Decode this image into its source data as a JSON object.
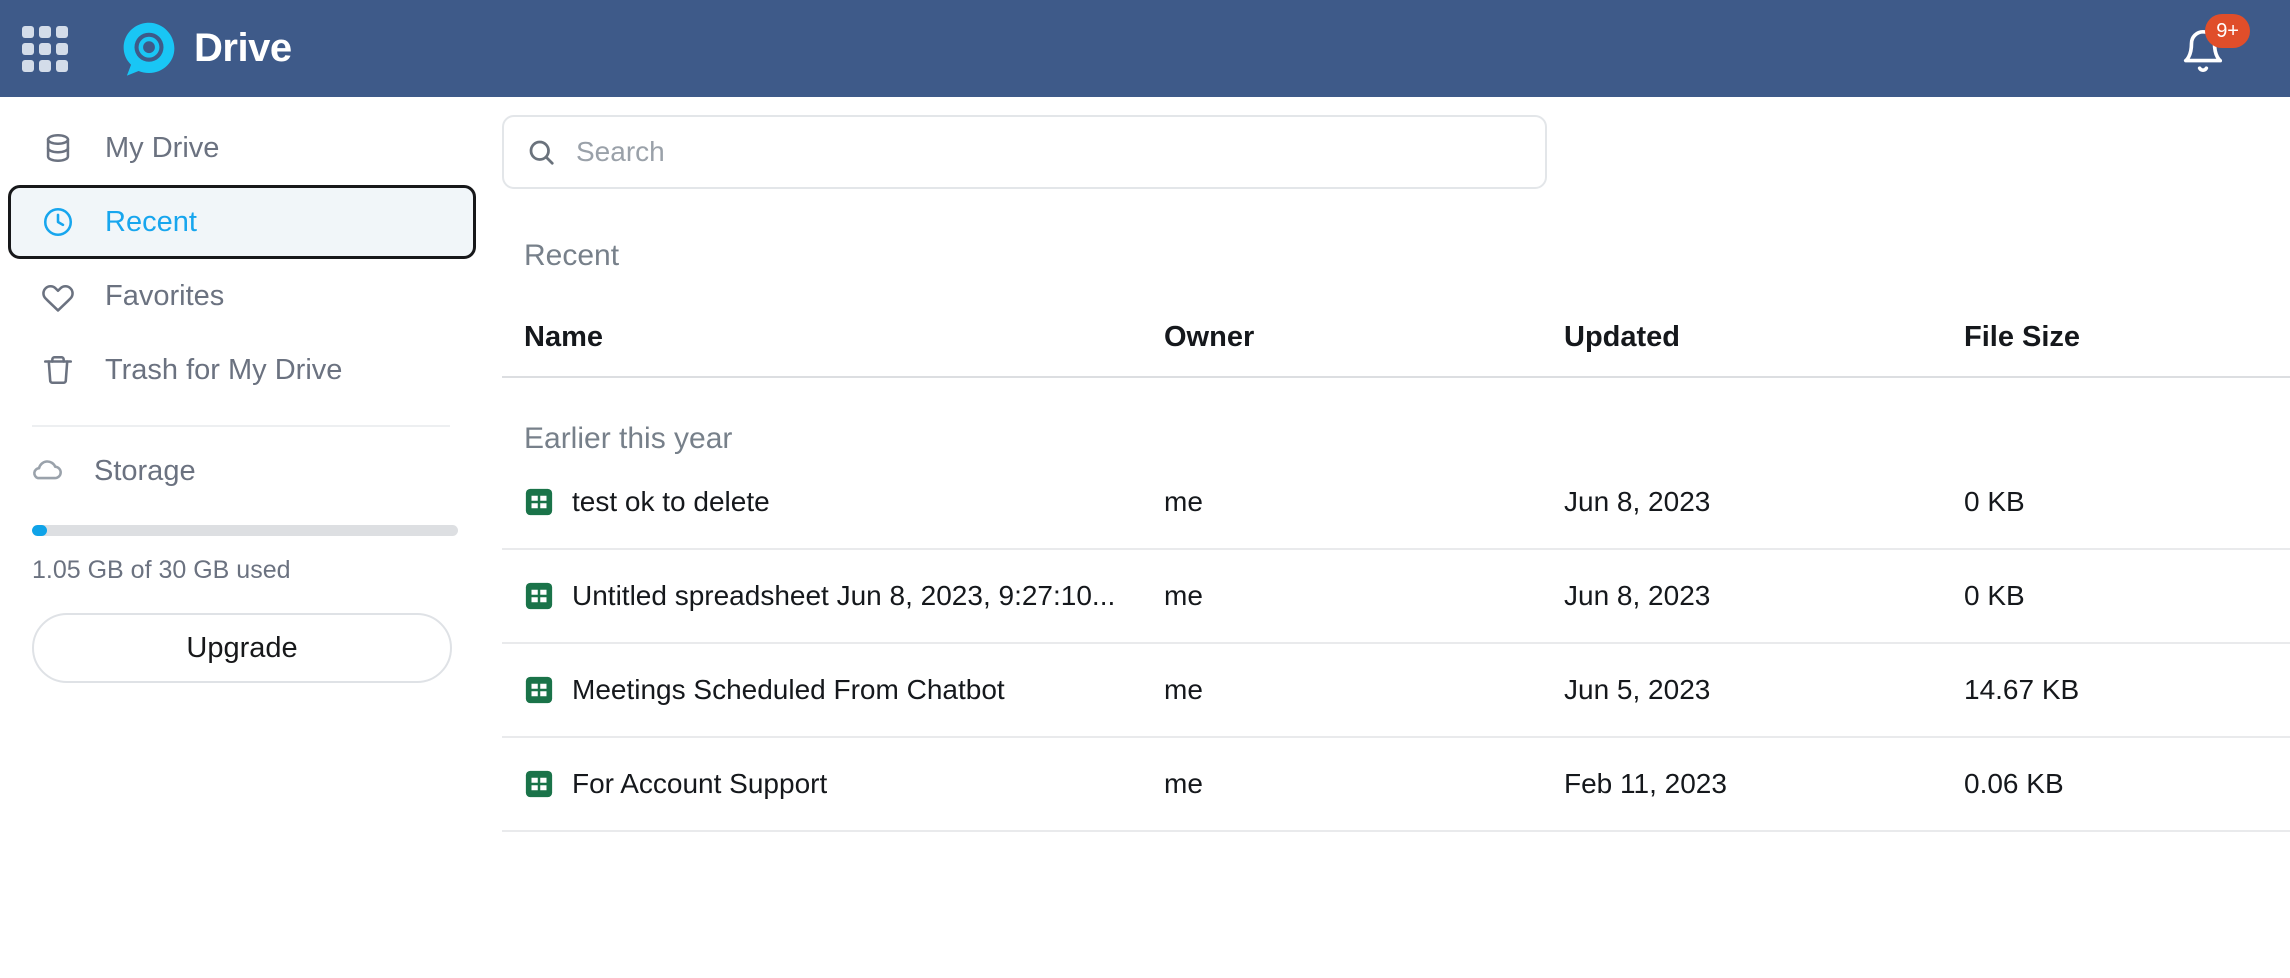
{
  "header": {
    "apps_icon": "apps-grid-icon",
    "logo_icon": "drive-chat-logo-icon",
    "title": "Drive",
    "bell_icon": "bell-icon",
    "notification_count": "9+",
    "bar_color": "#3E5A89",
    "badge_color": "#E04E2A"
  },
  "sidebar": {
    "items": [
      {
        "label": "My Drive",
        "icon": "database-icon",
        "selected": false
      },
      {
        "label": "Recent",
        "icon": "clock-icon",
        "selected": true
      },
      {
        "label": "Favorites",
        "icon": "heart-icon",
        "selected": false
      },
      {
        "label": "Trash for My Drive",
        "icon": "trash-icon",
        "selected": false
      }
    ],
    "storage": {
      "label": "Storage",
      "icon": "cloud-icon",
      "used_percent": 3.5,
      "usage_text": "1.05 GB of 30 GB used",
      "upgrade_label": "Upgrade",
      "fill_color": "#0FA3E8",
      "track_color": "#DDDFE2"
    },
    "accent_color": "#17A6EE",
    "selected_bg": "#F1F6F9"
  },
  "search": {
    "icon": "search-icon",
    "placeholder": "Search",
    "value": ""
  },
  "main": {
    "section_title": "Recent",
    "columns": [
      "Name",
      "Owner",
      "Updated",
      "File Size"
    ],
    "groups": [
      {
        "label": "Earlier this year",
        "rows": [
          {
            "icon": "spreadsheet-icon",
            "name": "test ok to delete",
            "owner": "me",
            "updated": "Jun 8, 2023",
            "size": "0 KB"
          },
          {
            "icon": "spreadsheet-icon",
            "name": "Untitled spreadsheet Jun 8, 2023, 9:27:10...",
            "owner": "me",
            "updated": "Jun 8, 2023",
            "size": "0 KB"
          },
          {
            "icon": "spreadsheet-icon",
            "name": "Meetings Scheduled From Chatbot",
            "owner": "me",
            "updated": "Jun 5, 2023",
            "size": "14.67 KB"
          },
          {
            "icon": "spreadsheet-icon",
            "name": "For Account Support",
            "owner": "me",
            "updated": "Feb 11, 2023",
            "size": "0.06 KB"
          }
        ]
      }
    ],
    "file_icon_color": "#1A7349"
  }
}
